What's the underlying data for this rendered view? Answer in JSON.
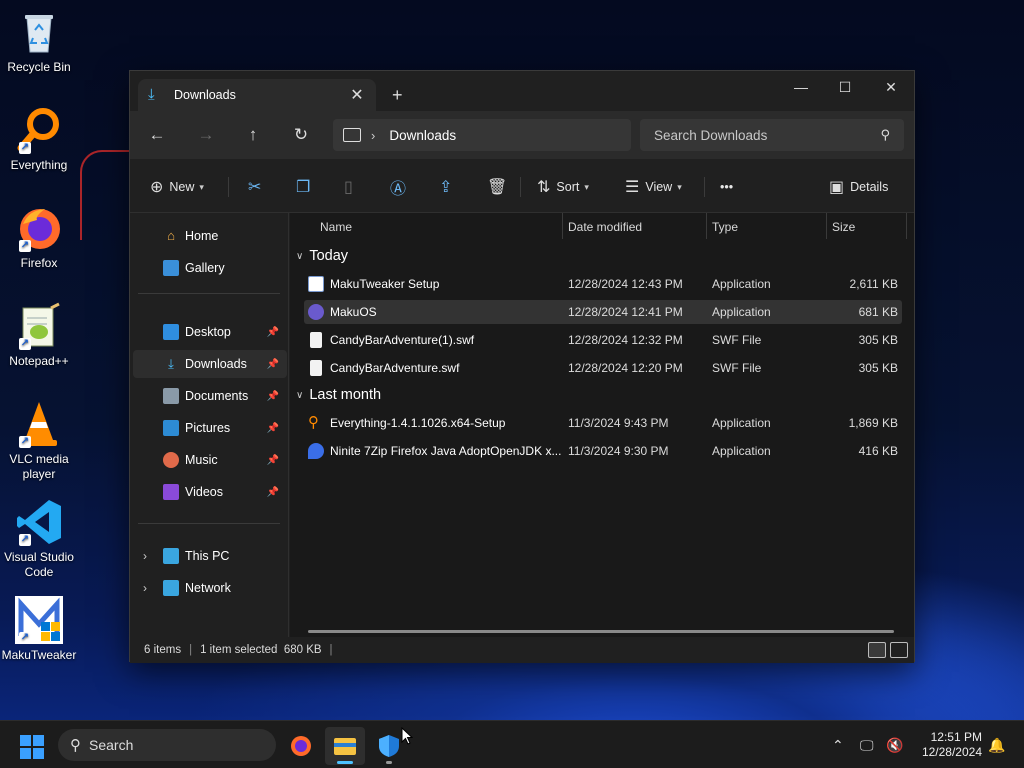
{
  "desktop": {
    "icons": [
      {
        "label": "Recycle Bin",
        "icon": "recycle-bin-icon"
      },
      {
        "label": "Everything",
        "icon": "everything-icon"
      },
      {
        "label": "Firefox",
        "icon": "firefox-icon"
      },
      {
        "label": "Notepad++",
        "icon": "notepad-plus-plus-icon"
      },
      {
        "label": "VLC media player",
        "icon": "vlc-icon"
      },
      {
        "label": "Visual Studio Code",
        "icon": "vscode-icon"
      },
      {
        "label": "MakuTweaker",
        "icon": "makutweaker-icon"
      }
    ]
  },
  "window": {
    "tab_title": "Downloads",
    "address": {
      "crumb": "Downloads"
    },
    "search_placeholder": "Search Downloads",
    "toolbar": {
      "new_label": "New",
      "sort_label": "Sort",
      "view_label": "View",
      "more_label": "•••",
      "details_label": "Details"
    },
    "sidebar": {
      "items": [
        {
          "label": "Home",
          "icon": "home-icon"
        },
        {
          "label": "Gallery",
          "icon": "gallery-icon"
        },
        {
          "label": "Desktop",
          "icon": "desktop-icon",
          "pinned": true
        },
        {
          "label": "Downloads",
          "icon": "downloads-icon",
          "pinned": true,
          "selected": true
        },
        {
          "label": "Documents",
          "icon": "documents-icon",
          "pinned": true
        },
        {
          "label": "Pictures",
          "icon": "pictures-icon",
          "pinned": true
        },
        {
          "label": "Music",
          "icon": "music-icon",
          "pinned": true
        },
        {
          "label": "Videos",
          "icon": "videos-icon",
          "pinned": true
        },
        {
          "label": "This PC",
          "icon": "this-pc-icon"
        },
        {
          "label": "Network",
          "icon": "network-icon"
        }
      ]
    },
    "columns": {
      "name": "Name",
      "date": "Date modified",
      "type": "Type",
      "size": "Size"
    },
    "groups": [
      {
        "label": "Today",
        "files": [
          {
            "name": "MakuTweaker Setup",
            "date": "12/28/2024 12:43 PM",
            "type": "Application",
            "size": "2,611 KB"
          },
          {
            "name": "MakuOS",
            "date": "12/28/2024 12:41 PM",
            "type": "Application",
            "size": "681 KB",
            "selected": true
          },
          {
            "name": "CandyBarAdventure(1).swf",
            "date": "12/28/2024 12:32 PM",
            "type": "SWF File",
            "size": "305 KB"
          },
          {
            "name": "CandyBarAdventure.swf",
            "date": "12/28/2024 12:20 PM",
            "type": "SWF File",
            "size": "305 KB"
          }
        ]
      },
      {
        "label": "Last month",
        "files": [
          {
            "name": "Everything-1.4.1.1026.x64-Setup",
            "date": "11/3/2024 9:43 PM",
            "type": "Application",
            "size": "1,869 KB"
          },
          {
            "name": "Ninite 7Zip Firefox Java AdoptOpenJDK x...",
            "date": "11/3/2024 9:30 PM",
            "type": "Application",
            "size": "416 KB"
          }
        ]
      }
    ],
    "status": {
      "items": "6 items",
      "selected": "1 item selected  680 KB"
    }
  },
  "taskbar": {
    "search_label": "Search",
    "time": "12:51 PM",
    "date": "12/28/2024"
  },
  "colors": {
    "accent": "#4cc2ff",
    "window_bg": "#202020",
    "content_bg": "#191919"
  }
}
